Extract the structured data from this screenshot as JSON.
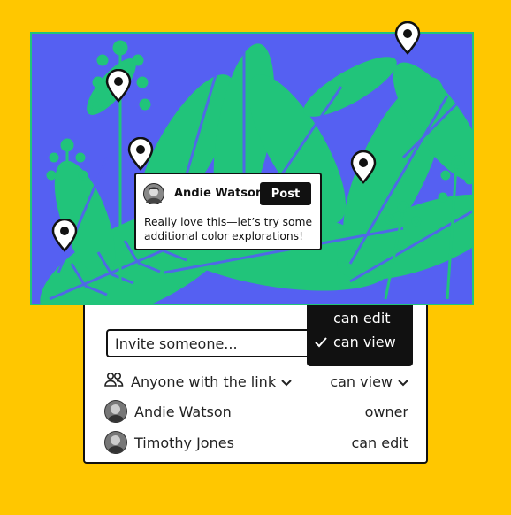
{
  "comment": {
    "author": "Andie Watson",
    "post_label": "Post",
    "text": "Really love this—let’s try some additional color explorations!"
  },
  "share": {
    "invite_placeholder": "Invite someone...",
    "link_access_label": "Anyone with the link",
    "link_permission": "can view",
    "menu": {
      "options": [
        "can edit",
        "can view"
      ],
      "selected": "can view"
    },
    "people": [
      {
        "name": "Andie Watson",
        "role": "owner"
      },
      {
        "name": "Timothy Jones",
        "role": "can edit"
      }
    ]
  },
  "icons": {
    "pin": "location-pin-icon",
    "people": "people-icon",
    "chevron": "chevron-down-icon",
    "check": "check-icon"
  },
  "colors": {
    "background": "#FFC700",
    "canvas": "#5560F2",
    "foliage": "#21C47A",
    "ink": "#111111"
  }
}
